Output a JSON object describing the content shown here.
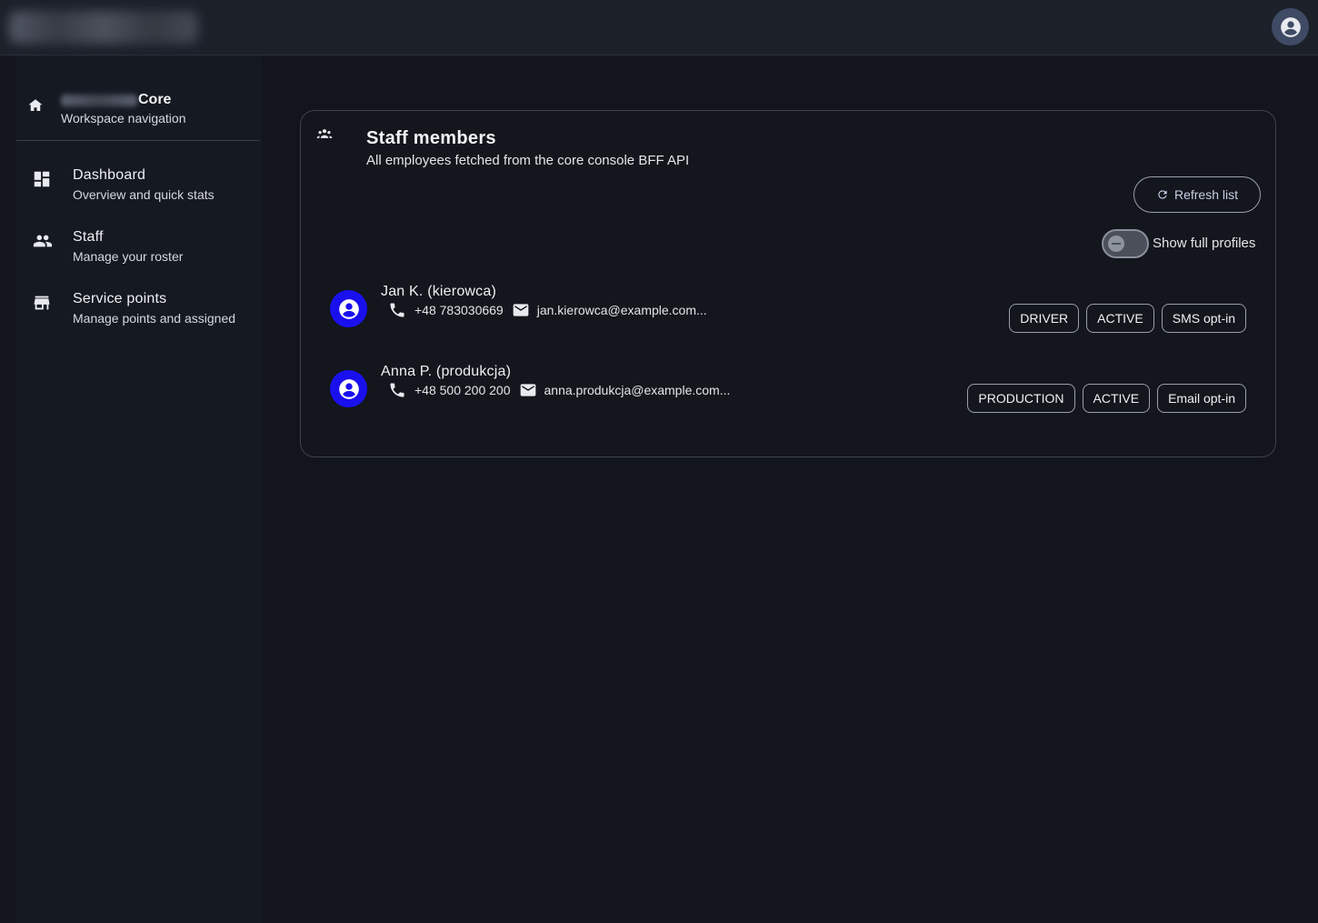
{
  "header": {
    "account_icon": "account-circle-icon"
  },
  "sidebar": {
    "brand_suffix": "Core",
    "subtitle": "Workspace navigation",
    "items": [
      {
        "label": "Dashboard",
        "sub": "Overview and quick stats",
        "icon": "dashboard-icon"
      },
      {
        "label": "Staff",
        "sub": "Manage your roster",
        "icon": "people-icon"
      },
      {
        "label": "Service points",
        "sub": "Manage points and assigned",
        "icon": "storefront-icon"
      }
    ]
  },
  "card": {
    "title": "Staff members",
    "subtitle": "All employees fetched from the core console BFF API",
    "refresh_label": "Refresh list",
    "toggle_label": "Show full profiles",
    "toggle_on": false,
    "employees": [
      {
        "name": "Jan K. (kierowca)",
        "phone": "+48 783030669",
        "email": "jan.kierowca@example.com",
        "tags": [
          "DRIVER",
          "ACTIVE",
          "SMS opt-in"
        ]
      },
      {
        "name": "Anna P. (produkcja)",
        "phone": "+48 500 200 200",
        "email": "anna.produkcja@example.com",
        "tags": [
          "PRODUCTION",
          "ACTIVE",
          "Email opt-in"
        ]
      }
    ]
  },
  "colors": {
    "accent": "#1a10ee",
    "background": "#12151b",
    "topbar": "#1c2029"
  }
}
